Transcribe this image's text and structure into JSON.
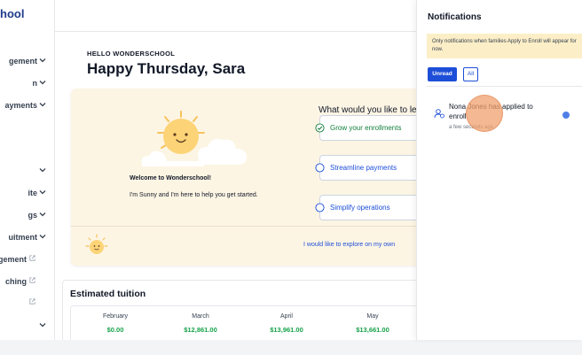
{
  "sidebar": {
    "brand": "hool",
    "items": [
      {
        "label": "gement",
        "chevron": true,
        "external": false
      },
      {
        "label": "n",
        "chevron": true,
        "external": false
      },
      {
        "label": "ayments",
        "chevron": true,
        "external": false
      },
      {
        "label": "",
        "chevron": true,
        "external": false
      },
      {
        "label": "ite",
        "chevron": true,
        "external": false
      },
      {
        "label": "gs",
        "chevron": true,
        "external": false
      },
      {
        "label": "uitment",
        "chevron": true,
        "external": false
      },
      {
        "label": "nagement",
        "chevron": false,
        "external": true
      },
      {
        "label": "ching",
        "chevron": false,
        "external": true
      },
      {
        "label": "",
        "chevron": false,
        "external": true
      },
      {
        "label": "",
        "chevron": true,
        "external": false
      }
    ]
  },
  "main": {
    "hello_small": "HELLO WONDERSCHOOL",
    "hello_big": "Happy Thursday, Sara",
    "welcome": {
      "title": "Welcome to Wonderschool!",
      "text": "I'm Sunny and I'm here to help you get started.",
      "question": "What would you like to le",
      "options": [
        {
          "label": "Grow your enrollments",
          "checked": true
        },
        {
          "label": "Streamline payments",
          "checked": false
        },
        {
          "label": "Simplify operations",
          "checked": false
        }
      ],
      "explore_link": "I would like to explore on my own"
    },
    "tuition": {
      "title": "Estimated tuition",
      "months": [
        {
          "month": "February",
          "amount": "$0.00"
        },
        {
          "month": "March",
          "amount": "$12,861.00"
        },
        {
          "month": "April",
          "amount": "$13,961.00"
        },
        {
          "month": "May",
          "amount": "$13,661.00"
        }
      ]
    }
  },
  "notifications": {
    "title": "Notifications",
    "banner": "Only notifications when families Apply to Enroll will appear for now.",
    "tabs": {
      "unread": "Unread",
      "all": "All"
    },
    "items": [
      {
        "message": "Nona Jones has applied to enroll",
        "time": "a few seconds ago",
        "unread": true
      }
    ]
  },
  "colors": {
    "accent": "#1d4ed8",
    "card_bg": "#fdf5e4",
    "success": "#16a34a",
    "success_check": "#15803d",
    "banner_bg": "#fcefc7",
    "sun": "#fcd477",
    "unread_dot": "#4f7fe6"
  },
  "icons": {
    "chevron": "chevron-down-icon",
    "external": "external-link-icon",
    "check": "check-circle-icon",
    "radio": "radio-circle-icon",
    "avatar": "user-icon",
    "mascot": "sun-mascot-icon"
  }
}
